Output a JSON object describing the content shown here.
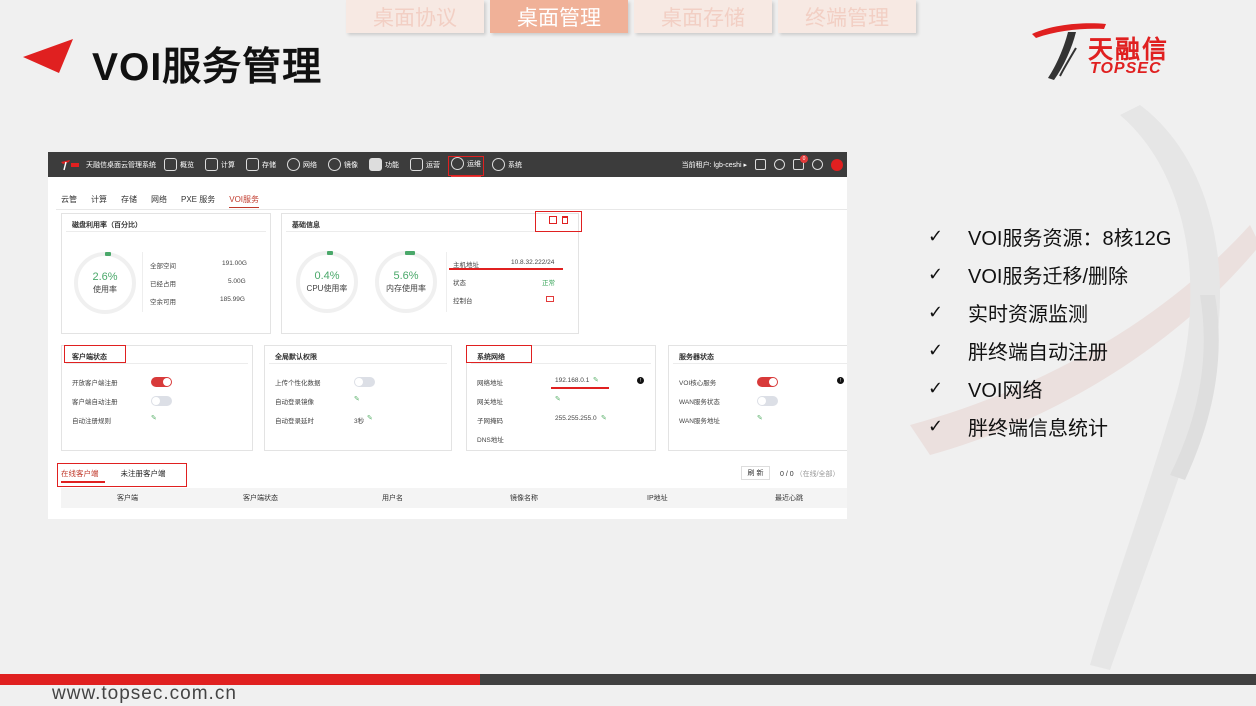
{
  "top_tabs": [
    {
      "label": "桌面协议",
      "active": false
    },
    {
      "label": "桌面管理",
      "active": true
    },
    {
      "label": "桌面存储",
      "active": false
    },
    {
      "label": "终端管理",
      "active": false
    }
  ],
  "title": "VOI服务管理",
  "logo": {
    "cn": "天融信",
    "en": "TOPSEC"
  },
  "app": {
    "name": "天融信桌面云管理系统",
    "nav": [
      "概览",
      "计算",
      "存储",
      "网络",
      "镜像",
      "功能",
      "运营",
      "运维",
      "系统"
    ],
    "active_nav": "运维",
    "tenant_label": "当前租户:",
    "tenant": "lgb-ceshi",
    "notification_count": "0",
    "subtabs": [
      "云管",
      "计算",
      "存储",
      "网络",
      "PXE 服务",
      "VOI服务"
    ],
    "active_subtab": "VOI服务",
    "disk": {
      "title": "磁盘利用率（百分比）",
      "pct": "2.6%",
      "pct_label": "使用率",
      "rows": [
        {
          "k": "全部空间",
          "v": "191.00G"
        },
        {
          "k": "已经占用",
          "v": "5.00G"
        },
        {
          "k": "空余可用",
          "v": "185.99G"
        }
      ]
    },
    "basic": {
      "title": "基础信息",
      "cpu_pct": "0.4%",
      "cpu_label": "CPU使用率",
      "mem_pct": "5.6%",
      "mem_label": "内存使用率",
      "host_label": "主机地址",
      "host_value": "10.8.32.222/24",
      "status_label": "状态",
      "status_value": "正常",
      "console_label": "控制台"
    },
    "client_status": {
      "title": "客户端状态",
      "rows": [
        "开放客户端注册",
        "客户端自动注册",
        "自动注册规则"
      ]
    },
    "global_perm": {
      "title": "全局默认权限",
      "rows": [
        "上传个性化数据",
        "自动登录镜像",
        "自动登录延时"
      ],
      "delay_value": "3秒"
    },
    "sys_net": {
      "title": "系统网络",
      "rows": [
        {
          "k": "网络地址",
          "v": "192.168.0.1"
        },
        {
          "k": "网关地址",
          "v": ""
        },
        {
          "k": "子网掩码",
          "v": "255.255.255.0"
        },
        {
          "k": "DNS地址",
          "v": ""
        }
      ]
    },
    "server_status": {
      "title": "服务器状态",
      "rows": [
        "VOI核心服务",
        "WAN服务状态",
        "WAN服务地址"
      ]
    },
    "client_tabs": [
      "在线客户端",
      "未注册客户端"
    ],
    "refresh_label": "刷 新",
    "pager": "0 / 0",
    "pager_note": "（在线/全部）",
    "columns": [
      "客户端",
      "客户端状态",
      "用户名",
      "镜像名称",
      "IP地址",
      "最近心跳"
    ]
  },
  "bullets": [
    "VOI服务资源：8核12G",
    "VOI服务迁移/删除",
    "实时资源监测",
    "胖终端自动注册",
    "VOI网络",
    "胖终端信息统计"
  ],
  "footer_url": "www.topsec.com.cn",
  "colors": {
    "brand_red": "#e02020",
    "dark": "#404040",
    "green": "#4aa86a"
  }
}
